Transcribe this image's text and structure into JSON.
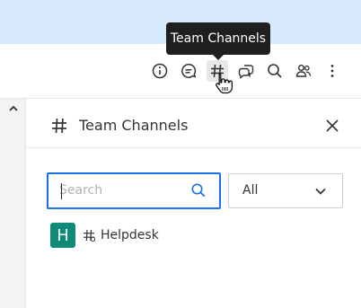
{
  "header": {
    "tooltip": "Team Channels",
    "icons": [
      "info-icon",
      "chat-icon",
      "hashtag-icon",
      "discussion-icon",
      "search-icon",
      "people-icon",
      "more-icon"
    ]
  },
  "panel": {
    "title": "Team Channels",
    "search_placeholder": "Search",
    "filter_value": "All"
  },
  "channels": [
    {
      "avatar_letter": "H",
      "name": "Helpdesk",
      "avatar_color": "#0f8a79"
    }
  ],
  "colors": {
    "banner": "#d7eafc",
    "accent": "#1a73e8",
    "avatar": "#0f8a79",
    "tooltip_bg": "#1f1f1f"
  }
}
